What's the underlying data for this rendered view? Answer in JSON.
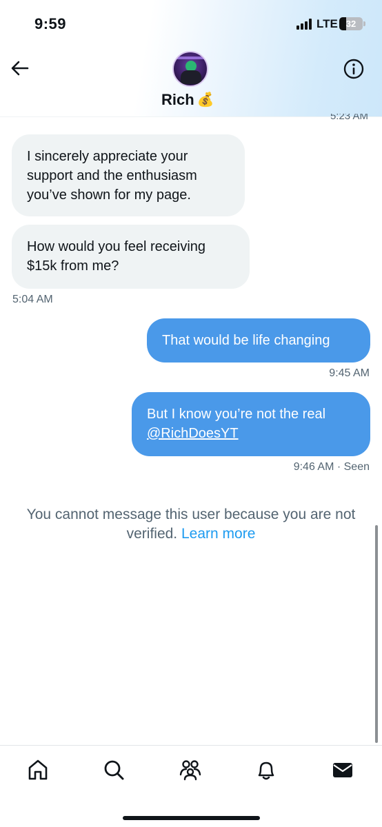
{
  "status_bar": {
    "time": "9:59",
    "carrier": "LTE",
    "battery": "32"
  },
  "header": {
    "name": "Rich",
    "emoji": "💰"
  },
  "conversation": {
    "partial_timestamp": "5:23 AM",
    "messages": [
      {
        "direction": "in",
        "text": "I sincerely appreciate your support and the enthusiasm you’ve shown for my page."
      },
      {
        "direction": "in",
        "text": "How would you feel receiving $15k from me?",
        "time": "5:04 AM"
      },
      {
        "direction": "out",
        "text": "That would be life changing",
        "time": "9:45 AM"
      },
      {
        "direction": "out",
        "text_before": "But I know you’re not the real",
        "mention": "@RichDoesYT",
        "time": "9:46 AM",
        "status": "Seen",
        "meta": "9:46 AM · Seen"
      }
    ]
  },
  "notice": {
    "text": "You cannot message this user because you are not verified.",
    "link": "Learn more"
  },
  "colors": {
    "outgoing_bubble": "#4a99e9",
    "incoming_bubble": "#eff3f4",
    "link": "#1d9bf0",
    "muted_text": "#536471"
  },
  "tabbar": {
    "items": [
      {
        "name": "home",
        "icon": "home-icon"
      },
      {
        "name": "search",
        "icon": "search-icon"
      },
      {
        "name": "communities",
        "icon": "communities-icon"
      },
      {
        "name": "notifications",
        "icon": "bell-icon"
      },
      {
        "name": "messages",
        "icon": "envelope-icon",
        "active": true
      }
    ]
  }
}
